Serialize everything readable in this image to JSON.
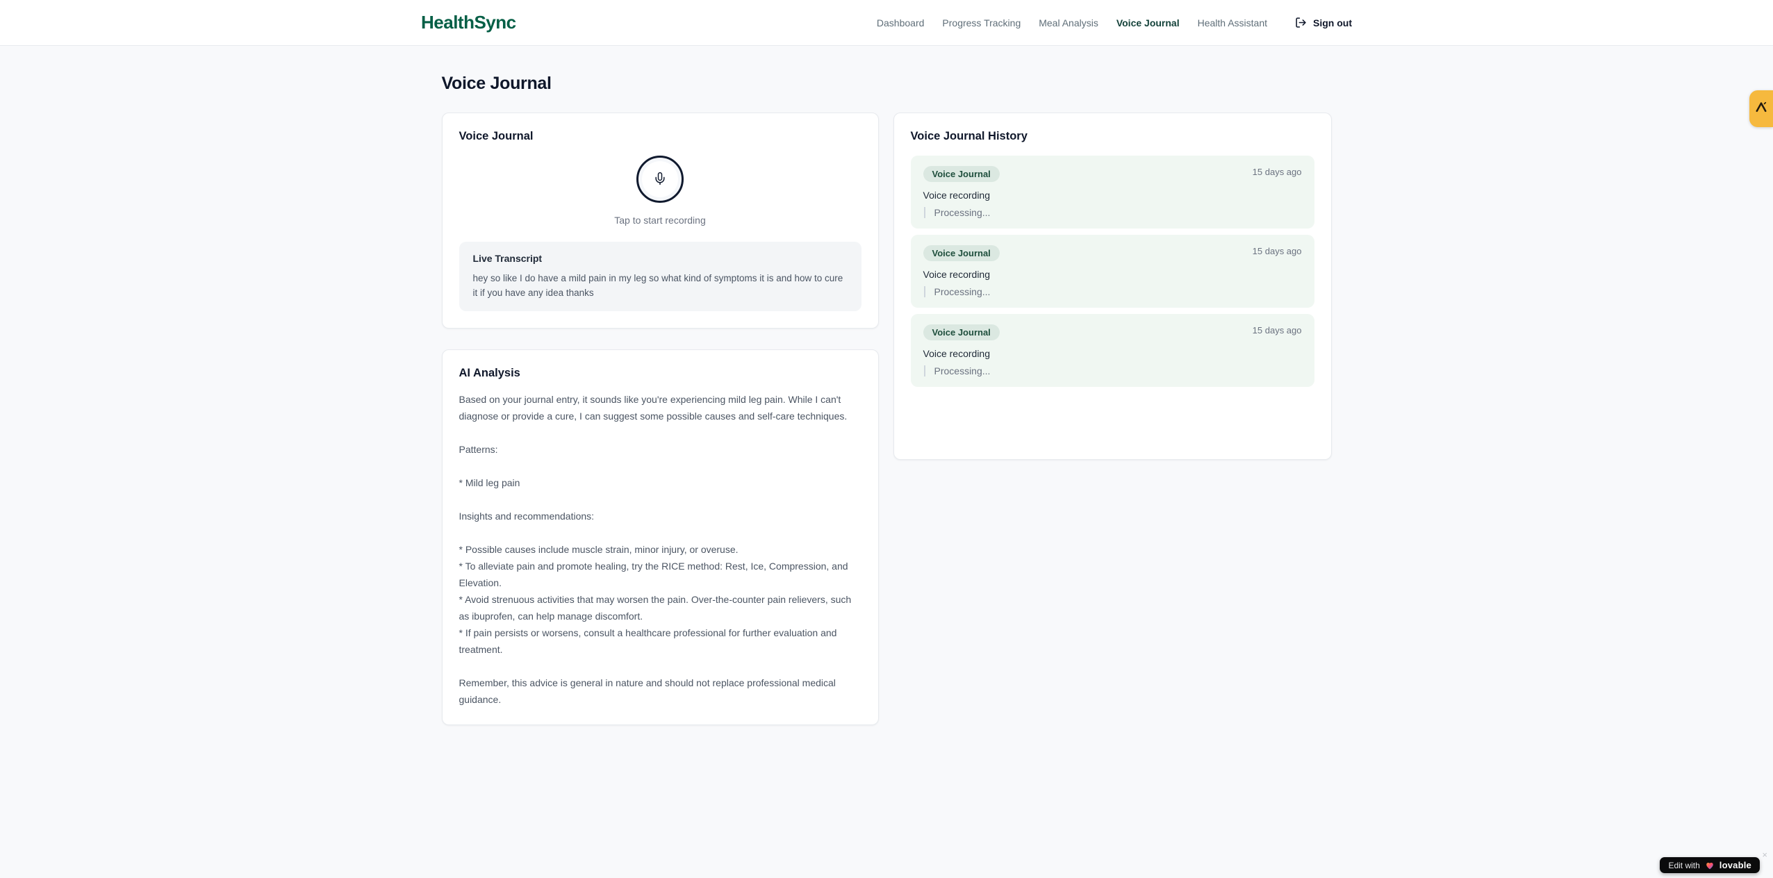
{
  "app": {
    "name": "HealthSync"
  },
  "nav": {
    "items": [
      {
        "label": "Dashboard",
        "active": false
      },
      {
        "label": "Progress Tracking",
        "active": false
      },
      {
        "label": "Meal Analysis",
        "active": false
      },
      {
        "label": "Voice Journal",
        "active": true
      },
      {
        "label": "Health Assistant",
        "active": false
      }
    ],
    "sign_out_label": "Sign out"
  },
  "page": {
    "title": "Voice Journal"
  },
  "recorder": {
    "card_title": "Voice Journal",
    "tap_hint": "Tap to start recording",
    "transcript_title": "Live Transcript",
    "transcript_text": "hey so like I do have a mild pain in my leg so what kind of symptoms it is and how to cure it if you have any idea thanks"
  },
  "analysis": {
    "card_title": "AI Analysis",
    "body": "Based on your journal entry, it sounds like you're experiencing mild leg pain. While I can't diagnose or provide a cure, I can suggest some possible causes and self-care techniques.\n\nPatterns:\n\n* Mild leg pain\n\nInsights and recommendations:\n\n* Possible causes include muscle strain, minor injury, or overuse.\n* To alleviate pain and promote healing, try the RICE method: Rest, Ice, Compression, and Elevation.\n* Avoid strenuous activities that may worsen the pain. Over-the-counter pain relievers, such as ibuprofen, can help manage discomfort.\n* If pain persists or worsens, consult a healthcare professional for further evaluation and treatment.\n\nRemember, this advice is general in nature and should not replace professional medical guidance."
  },
  "history": {
    "card_title": "Voice Journal History",
    "items": [
      {
        "badge": "Voice Journal",
        "time": "15 days ago",
        "title": "Voice recording",
        "status": "Processing..."
      },
      {
        "badge": "Voice Journal",
        "time": "15 days ago",
        "title": "Voice recording",
        "status": "Processing..."
      },
      {
        "badge": "Voice Journal",
        "time": "15 days ago",
        "title": "Voice recording",
        "status": "Processing..."
      }
    ]
  },
  "widgets": {
    "edit_badge": {
      "prefix": "Edit with",
      "brand": "lovable",
      "close": "×"
    }
  },
  "colors": {
    "brand_green": "#065f46",
    "active_nav": "#14423a",
    "history_item_bg": "#f0f7f2",
    "badge_bg": "#dbe8e1",
    "badge_text": "#1e4e3c",
    "side_tab_amber": "#f6b93e",
    "edit_badge_bg": "#0b0b0c",
    "page_bg": "#f8f9fb"
  }
}
